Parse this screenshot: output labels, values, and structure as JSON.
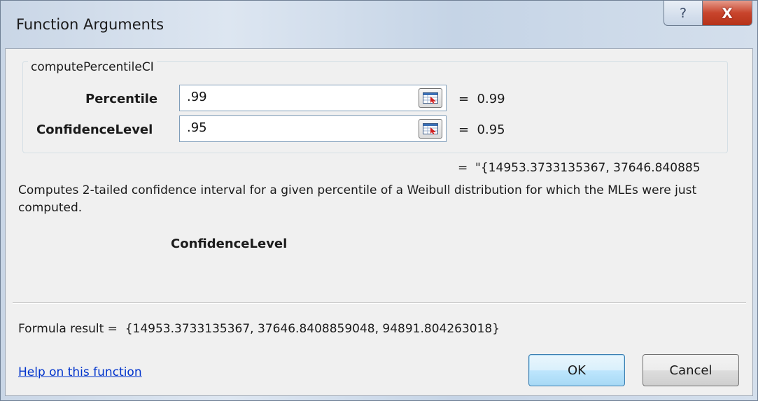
{
  "window": {
    "title": "Function Arguments",
    "help_glyph": "?",
    "close_glyph": "X"
  },
  "function": {
    "name": "computePercentileCI",
    "arguments": [
      {
        "label": "Percentile",
        "value": ".99",
        "result": "=  0.99"
      },
      {
        "label": "ConfidenceLevel",
        "value": ".95",
        "result": "=  0.95"
      }
    ],
    "preview_result": "=  \"{14953.3733135367, 37646.840885",
    "description": "Computes 2-tailed confidence interval for a given percentile of a Weibull distribution for which the MLEs were just computed.",
    "current_argument": "ConfidenceLevel"
  },
  "footer": {
    "formula_result": "Formula result =  {14953.3733135367, 37646.8408859048, 94891.804263018}",
    "help_link": "Help on this function",
    "ok_label": "OK",
    "cancel_label": "Cancel"
  },
  "icons": {
    "ref_button": "collapse-dialog-icon"
  },
  "colors": {
    "link": "#0033cc",
    "close_button": "#c8442c",
    "default_button_border": "#3c7fb1"
  }
}
